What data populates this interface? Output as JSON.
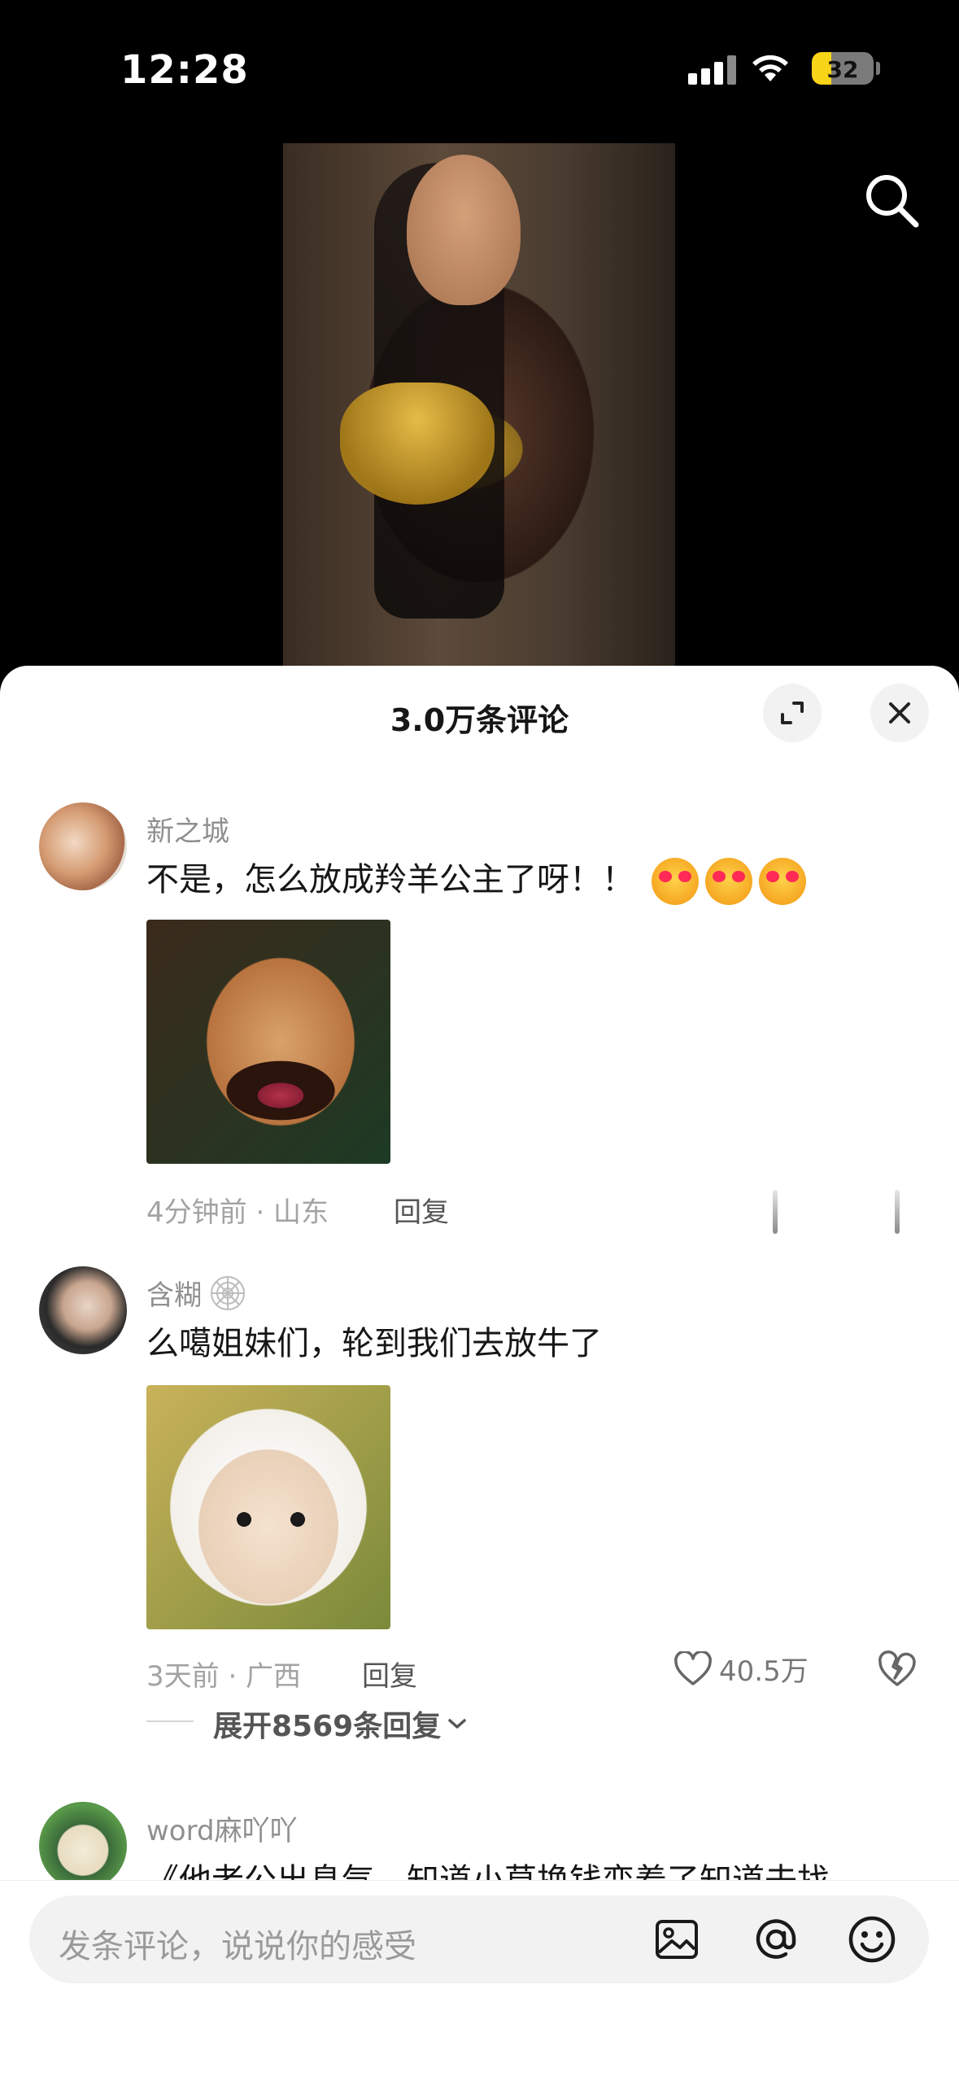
{
  "status_bar": {
    "time": "12:28",
    "battery": "32",
    "battery_level": 0.32
  },
  "video": {
    "description_icon": "search-icon"
  },
  "sheet": {
    "title": "3.0万条评论",
    "expand_icon": "expand-icon",
    "close_icon": "close-icon"
  },
  "comments": [
    {
      "name": "新之城",
      "text": "不是，怎么放成羚羊公主了呀！！",
      "emojis": [
        "heart-eyes-emoji",
        "heart-eyes-emoji",
        "heart-eyes-emoji"
      ],
      "meta": "4分钟前 · 山东",
      "reply": "回复"
    },
    {
      "name": "含糊",
      "badge_icon": "spiderweb-icon",
      "text": "么噶姐妹们，轮到我们去放牛了",
      "meta": "3天前 · 广西",
      "reply": "回复",
      "likes": "40.5万",
      "expand_replies": "展开8569条回复"
    },
    {
      "name": "word麻吖吖",
      "text": "《他老公出息气，知道小草换钱变着了知道去找"
    }
  ],
  "bottom_bar": {
    "placeholder": "发条评论，说说你的感受",
    "image_icon": "image-icon",
    "at_icon": "at-icon",
    "emoji_icon": "emoji-icon"
  }
}
